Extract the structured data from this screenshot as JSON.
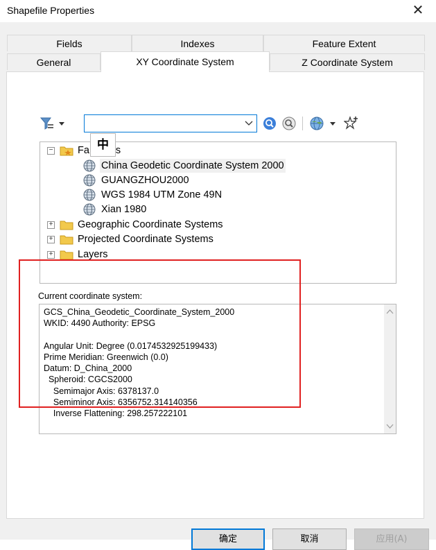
{
  "window": {
    "title": "Shapefile Properties",
    "close_glyph": "✕"
  },
  "tabs_row1": [
    "Fields",
    "Indexes",
    "Feature Extent"
  ],
  "tabs_row2": [
    "General",
    "XY Coordinate System",
    "Z Coordinate System"
  ],
  "active_tab": "XY Coordinate System",
  "toolbar": {
    "filter_icon": "filter-icon",
    "search_value": "",
    "search_icon": "search-icon",
    "clear_search_icon": "clear-search-icon",
    "globe_menu_icon": "globe-icon",
    "add_favorite_icon": "add-favorite-star-icon",
    "ime_char": "中"
  },
  "tree": {
    "favorites_label": "Favorites",
    "favorites_visible_tail": "s",
    "items": [
      "China Geodetic Coordinate System 2000",
      "GUANGZHOU2000",
      "WGS 1984 UTM Zone 49N",
      "Xian 1980"
    ],
    "folders": [
      "Geographic Coordinate Systems",
      "Projected Coordinate Systems",
      "Layers"
    ],
    "collapse_glyph": "−",
    "expand_glyph": "+"
  },
  "current": {
    "label": "Current coordinate system:",
    "lines": [
      "GCS_China_Geodetic_Coordinate_System_2000",
      "WKID: 4490 Authority: EPSG",
      "",
      "Angular Unit: Degree (0.0174532925199433)",
      "Prime Meridian: Greenwich (0.0)",
      "Datum: D_China_2000",
      "  Spheroid: CGCS2000",
      "    Semimajor Axis: 6378137.0",
      "    Semiminor Axis: 6356752.314140356",
      "    Inverse Flattening: 298.257222101"
    ]
  },
  "buttons": {
    "ok": "确定",
    "cancel": "取消",
    "apply": "应用(A)"
  },
  "colors": {
    "highlight": "#e02020",
    "focus": "#0078d7"
  }
}
